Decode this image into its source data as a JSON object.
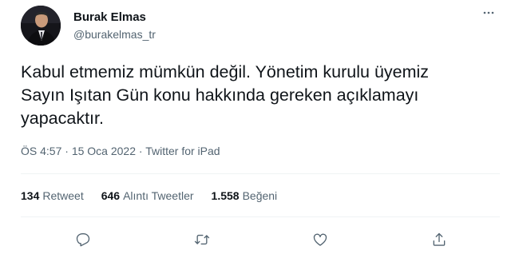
{
  "author": {
    "name": "Burak Elmas",
    "handle": "@burakelmas_tr",
    "avatar_icon": "profile-photo"
  },
  "more_icon": "more-horizontal-icon",
  "tweet": {
    "text": "Kabul etmemiz mümkün değil. Yönetim kurulu üyemiz\nSayın Işıtan Gün konu hakkında gereken açıklamayı\nyapacaktır."
  },
  "meta": {
    "time": "ÖS 4:57",
    "separator": "·",
    "date": "15 Oca 2022",
    "source": "Twitter for iPad"
  },
  "stats": {
    "retweets": {
      "count": "134",
      "label": "Retweet"
    },
    "quotes": {
      "count": "646",
      "label": "Alıntı Tweetler"
    },
    "likes": {
      "count": "1.558",
      "label": "Beğeni"
    }
  },
  "actions": [
    "reply-icon",
    "retweet-icon",
    "like-icon",
    "share-icon"
  ],
  "colors": {
    "text": "#0f1419",
    "secondary": "#536471",
    "divider": "#eff3f4"
  }
}
